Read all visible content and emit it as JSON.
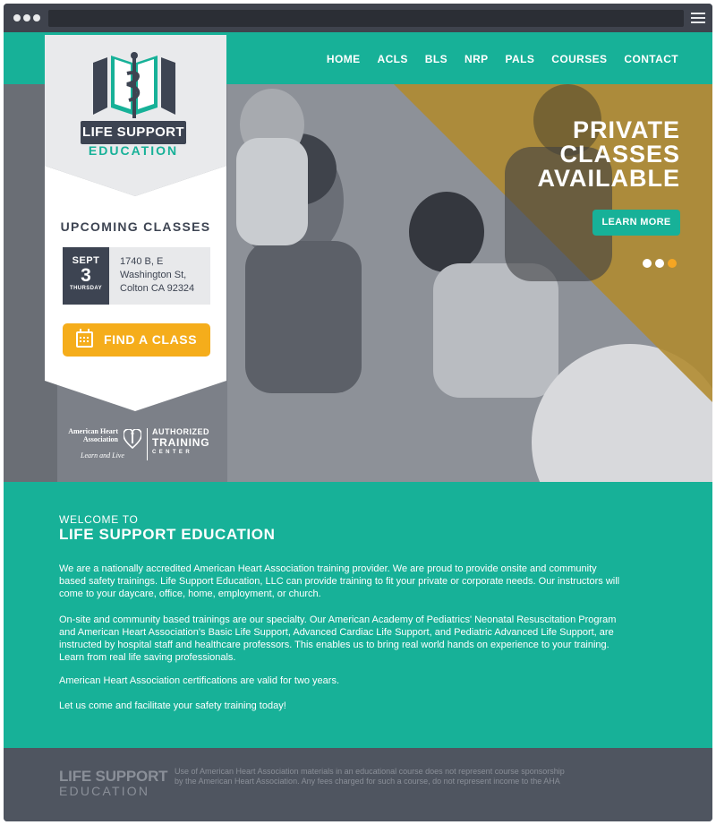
{
  "nav": {
    "items": [
      "HOME",
      "ACLS",
      "BLS",
      "NRP",
      "PALS",
      "COURSES",
      "CONTACT"
    ]
  },
  "logo": {
    "line1": "LIFE SUPPORT",
    "line2": "EDUCATION"
  },
  "hero": {
    "title_lines": [
      "PRIVATE",
      "CLASSES",
      "AVAILABLE"
    ],
    "cta": "LEARN MORE",
    "slides": 3,
    "active_slide": 3
  },
  "upcoming": {
    "heading": "UPCOMING CLASSES",
    "month": "SEPT",
    "day": "3",
    "weekday": "THURSDAY",
    "address_lines": [
      "1740 B, E",
      "Washington St,",
      "Colton CA 92324"
    ],
    "find_button": "FIND A CLASS"
  },
  "aha": {
    "name_lines": [
      "American Heart",
      "Association"
    ],
    "tagline": "Learn and Live",
    "authorized": "AUTHORIZED",
    "training": "TRAINING",
    "center": "CENTER"
  },
  "welcome": {
    "pre": "WELCOME TO",
    "title": "LIFE SUPPORT EDUCATION",
    "paragraphs": [
      "We are a nationally accredited American Heart Association training provider. We are proud to provide onsite and community based safety trainings. Life Support Education, LLC can provide training to fit your private or corporate needs. Our instructors will come to your daycare, office, home, employment, or church.",
      "On-site and community based trainings are our specialty. Our American Academy of Pediatrics' Neonatal Resuscitation Program and American Heart Association's Basic Life Support, Advanced Cardiac Life Support, and Pediatric Advanced Life Support, are instructed by hospital staff and healthcare professors. This enables us to bring real world hands on experience to your training. Learn from real life saving professionals.",
      "American Heart Association certifications are valid for two years.",
      "Let us come and facilitate your safety training today!"
    ]
  },
  "footer": {
    "logo_line1": "LIFE SUPPORT",
    "logo_line2": "EDUCATION",
    "disclaimer": "Use of American Heart Association materials in an educational course does not represent course sponsorship by the American Heart Association. Any fees charged for such a course, do not represent income to the AHA"
  },
  "colors": {
    "teal": "#17b198",
    "dark": "#3d4452",
    "gold": "#b08a2e",
    "orange": "#f5ad1b",
    "footer": "#4f5560"
  }
}
